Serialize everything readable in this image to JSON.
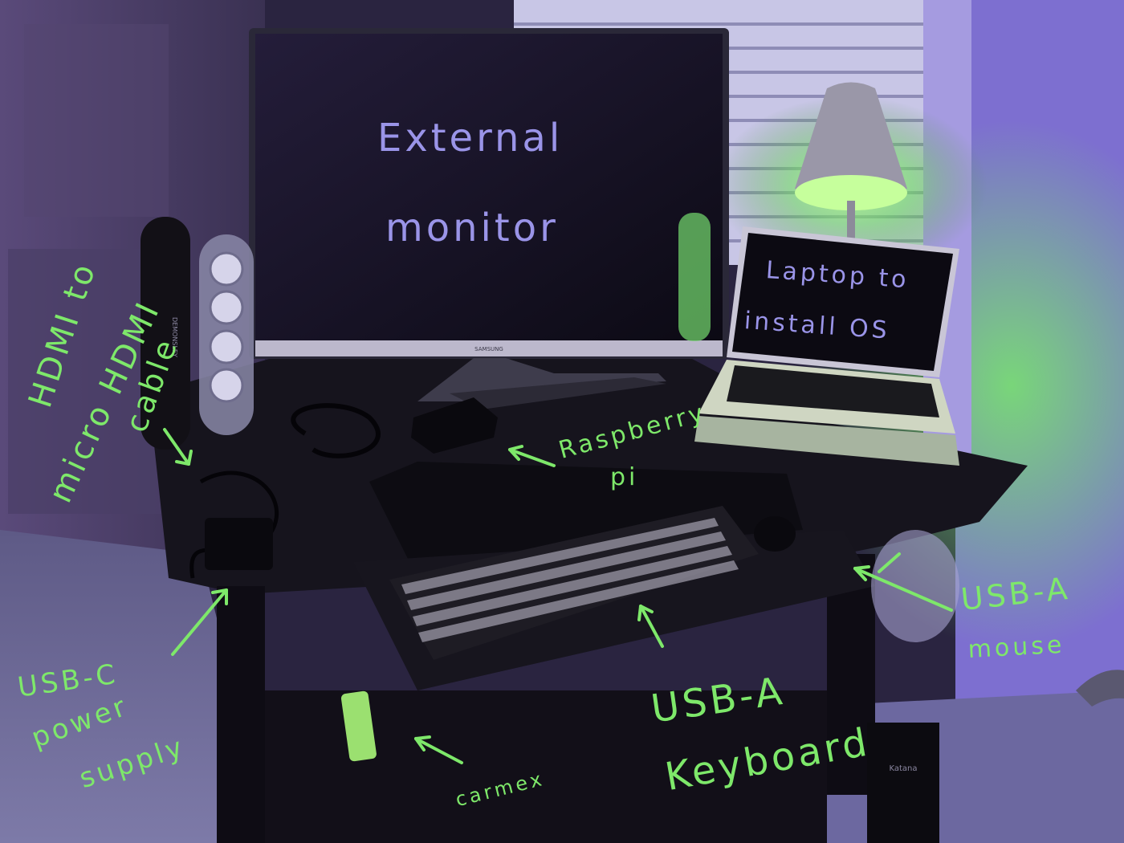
{
  "annotations": {
    "monitor_line1": "External",
    "monitor_line2": "monitor",
    "laptop_line1": "Laptop to",
    "laptop_line2": "install OS",
    "hdmi_line1": "HDMI to",
    "hdmi_line2": "micro HDMI",
    "hdmi_line3": "cable",
    "raspberry_line1": "Raspberry",
    "raspberry_line2": "pi",
    "usbc_line1": "USB-C",
    "usbc_line2": "power",
    "usbc_line3": "supply",
    "usba_mouse_line1": "USB-A",
    "usba_mouse_line2": "mouse",
    "usba_keyboard_line1": "USB-A",
    "usba_keyboard_line2": "Keyboard",
    "carmex": "carmex"
  },
  "brands": {
    "monitor": "SAMSUNG",
    "speaker": "DEMONSLEY",
    "tower": "Katana"
  },
  "colors": {
    "ink_green": "#7ee86a",
    "ink_purple": "#9a94e8",
    "wall": "#7d6fd0",
    "desk": "#16141d",
    "lamp_glow": "#8dff74"
  }
}
